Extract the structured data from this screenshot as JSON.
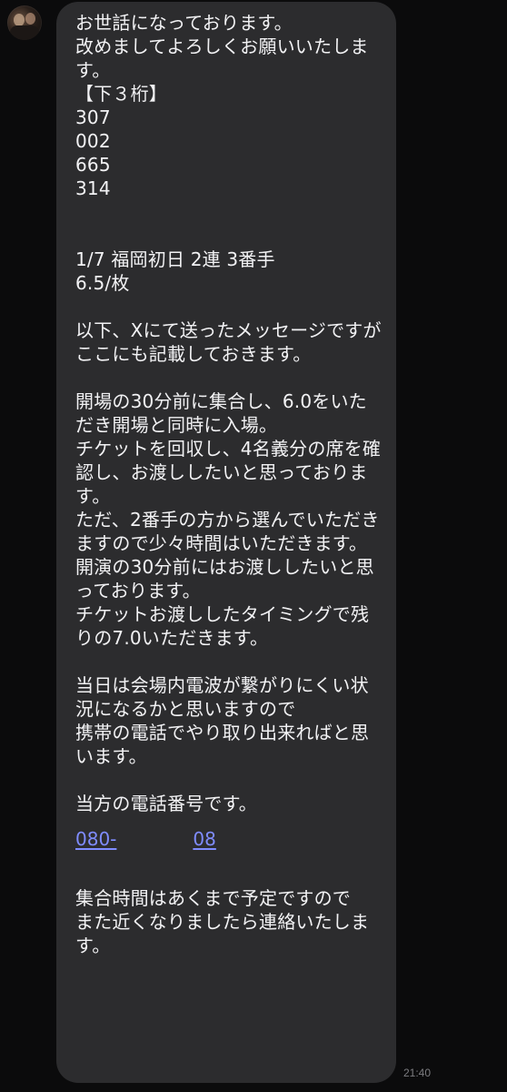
{
  "message": {
    "block_1": "お世話になっております。\n改めましてよろしくお願いいたします。\n【下３桁】\n307\n002\n665\n314\n\n\n1/7 福岡初日 2連 3番手\n6.5/枚\n\n以下、Xにて送ったメッセージですが\nここにも記載しておきます。\n\n開場の30分前に集合し、6.0をいただき開場と同時に入場。\nチケットを回収し、4名義分の席を確認し、お渡ししたいと思っております。\nただ、2番手の方から選んでいただきますので少々時間はいただきます。\n開演の30分前にはお渡ししたいと思っております。\nチケットお渡ししたタイミングで残りの7.0いただきます。\n\n当日は会場内電波が繋がりにくい状況になるかと思いますので\n携帯の電話でやり取り出来ればと思います。\n\n当方の電話番号です。",
    "phone_part_1": "080-",
    "phone_part_2": "08",
    "block_2": "集合時間はあくまで予定ですので\nまた近くなりましたら連絡いたします。"
  },
  "timestamp": "21:40",
  "colors": {
    "background": "#0b0b0c",
    "bubble": "#2c2c2e",
    "text": "#f2f2f4",
    "link": "#7f8cff",
    "timestamp": "#7c7c80"
  }
}
